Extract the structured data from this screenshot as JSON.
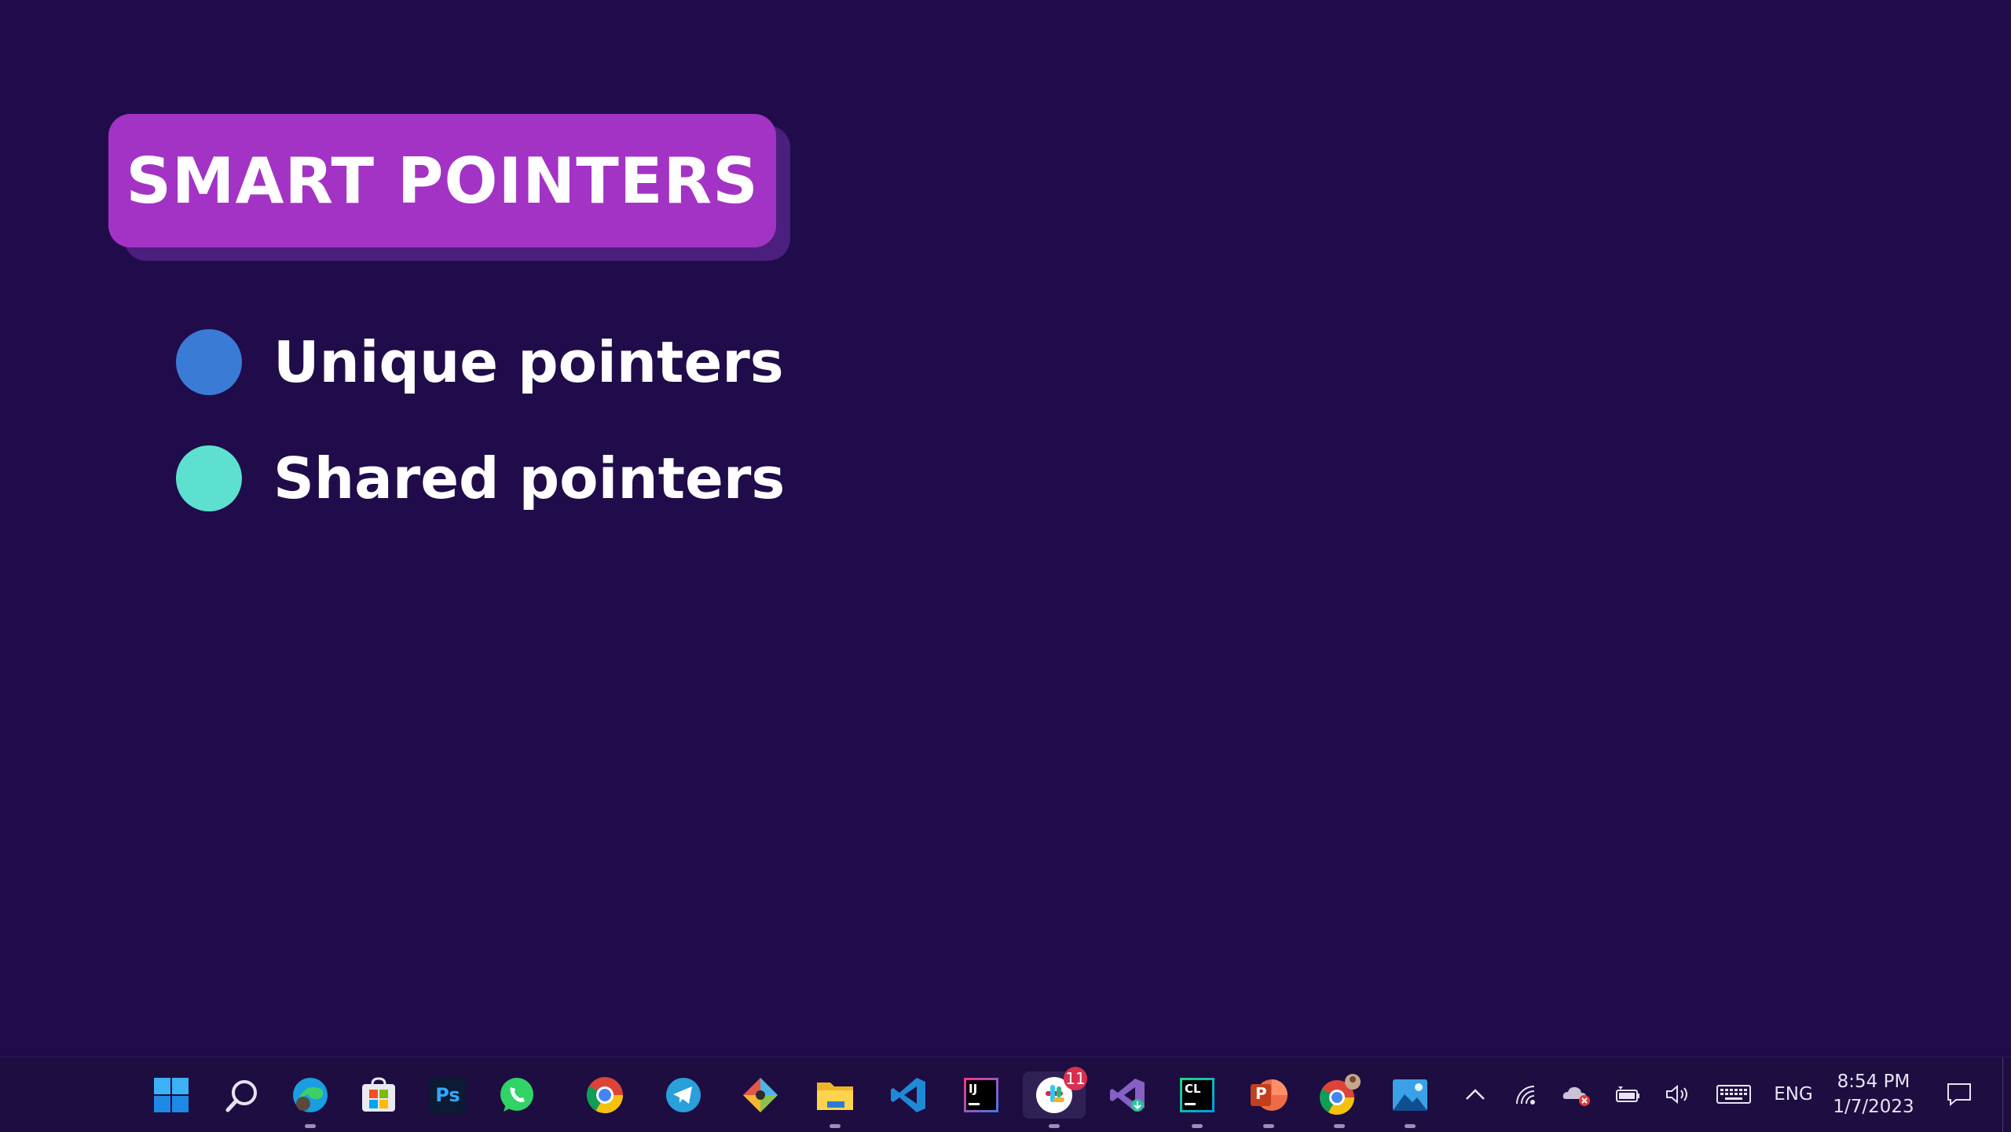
{
  "slide": {
    "title": "SMART POINTERS",
    "bullets": [
      {
        "label": "Unique pointers",
        "color": "#3a7bd5"
      },
      {
        "label": "Shared pointers",
        "color": "#5de0d0"
      }
    ],
    "colors": {
      "background": "#200c4a",
      "title_box": "#a333c4",
      "title_shadow": "#4a1f7d"
    }
  },
  "taskbar": {
    "apps": [
      {
        "icon": "windows-start-icon"
      },
      {
        "icon": "search-icon"
      },
      {
        "icon": "edge-icon"
      },
      {
        "icon": "microsoft-store-icon"
      },
      {
        "icon": "photoshop-icon",
        "text": "Ps"
      },
      {
        "icon": "whatsapp-icon"
      },
      {
        "icon": "chrome-icon"
      },
      {
        "icon": "telegram-icon"
      },
      {
        "icon": "git-client-icon"
      },
      {
        "icon": "file-explorer-icon"
      },
      {
        "icon": "vscode-icon"
      },
      {
        "icon": "intellij-icon",
        "text": "IJ"
      },
      {
        "icon": "slack-icon",
        "badge": "11"
      },
      {
        "icon": "visual-studio-icon"
      },
      {
        "icon": "clion-icon",
        "text": "CL"
      },
      {
        "icon": "powerpoint-icon",
        "text": "P"
      },
      {
        "icon": "chrome-profile-icon"
      },
      {
        "icon": "photos-icon"
      }
    ],
    "tray": {
      "language": "ENG",
      "time": "8:54 PM",
      "date": "1/7/2023"
    }
  }
}
